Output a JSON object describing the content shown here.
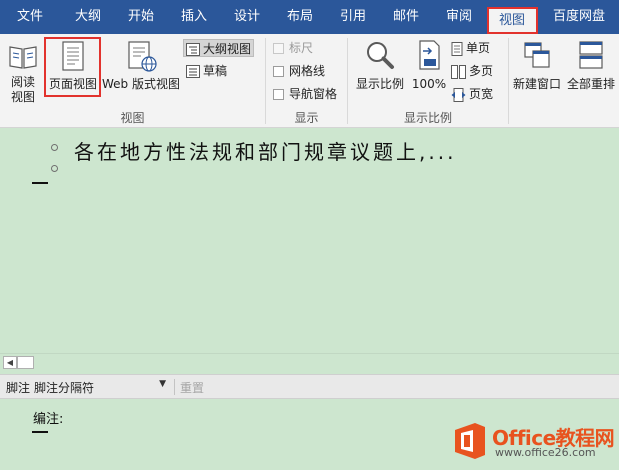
{
  "tabs": [
    {
      "label": "文件"
    },
    {
      "label": "大纲"
    },
    {
      "label": "开始"
    },
    {
      "label": "插入"
    },
    {
      "label": "设计"
    },
    {
      "label": "布局"
    },
    {
      "label": "引用"
    },
    {
      "label": "邮件"
    },
    {
      "label": "审阅"
    },
    {
      "label": "视图",
      "active": true
    },
    {
      "label": "百度网盘"
    }
  ],
  "ribbon": {
    "views_group": {
      "label": "视图",
      "read_mode": "阅读\n视图",
      "print_layout": "页面视图",
      "web_layout": "Web 版式视图",
      "outline": "大纲视图",
      "draft": "草稿"
    },
    "show_group": {
      "label": "显示",
      "ruler": "标尺",
      "gridlines": "网格线",
      "nav_pane": "导航窗格"
    },
    "zoom_group": {
      "label": "显示比例",
      "zoom": "显示比例",
      "hundred": "100%",
      "one_page": "单页",
      "multi_page": "多页",
      "page_width": "页宽"
    },
    "window_group": {
      "new_window": "新建窗口",
      "arrange_all": "全部重排"
    }
  },
  "document": {
    "outline_item": "各在地方性法规和部门规章议题上,..."
  },
  "footnote_bar": {
    "label": "脚注",
    "selected": "脚注分隔符",
    "reset": "重置"
  },
  "footnote_pane": {
    "note": "编注:"
  },
  "watermark": {
    "brand": "Office教程网",
    "url": "www.office26.com"
  },
  "colors": {
    "accent": "#2b579a",
    "highlight": "#e2322d",
    "doc_background": "#cde6cf",
    "watermark": "#e8531f"
  }
}
